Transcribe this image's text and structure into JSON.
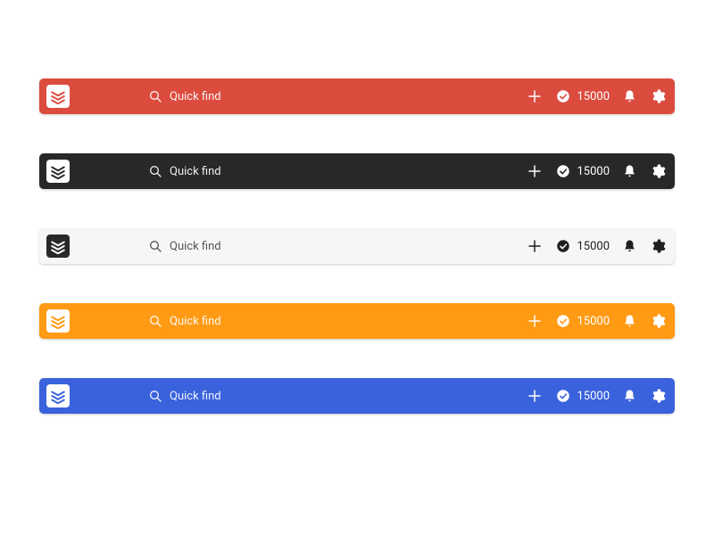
{
  "search_placeholder": "Quick find",
  "karma_count": "15000",
  "themes": [
    {
      "id": "red",
      "bar_bg": "#db4c3f",
      "logo_chip_bg": "#ffffff",
      "logo_glyph": "#db4c3f",
      "fg": "#ffffff"
    },
    {
      "id": "dark",
      "bar_bg": "#282828",
      "logo_chip_bg": "#ffffff",
      "logo_glyph": "#282828",
      "fg": "#ffffff"
    },
    {
      "id": "light",
      "bar_bg": "#f6f6f6",
      "logo_chip_bg": "#282828",
      "logo_glyph": "#ffffff",
      "fg": "#202020"
    },
    {
      "id": "orange",
      "bar_bg": "#ff9a14",
      "logo_chip_bg": "#ffffff",
      "logo_glyph": "#ff9a14",
      "fg": "#ffffff"
    },
    {
      "id": "blue",
      "bar_bg": "#3a62dc",
      "logo_chip_bg": "#ffffff",
      "logo_glyph": "#3a62dc",
      "fg": "#ffffff"
    }
  ],
  "icons": {
    "logo": "todoist-logo",
    "search": "search-icon",
    "add": "plus-icon",
    "karma": "check-circle-icon",
    "notifications": "bell-icon",
    "settings": "gear-icon"
  }
}
